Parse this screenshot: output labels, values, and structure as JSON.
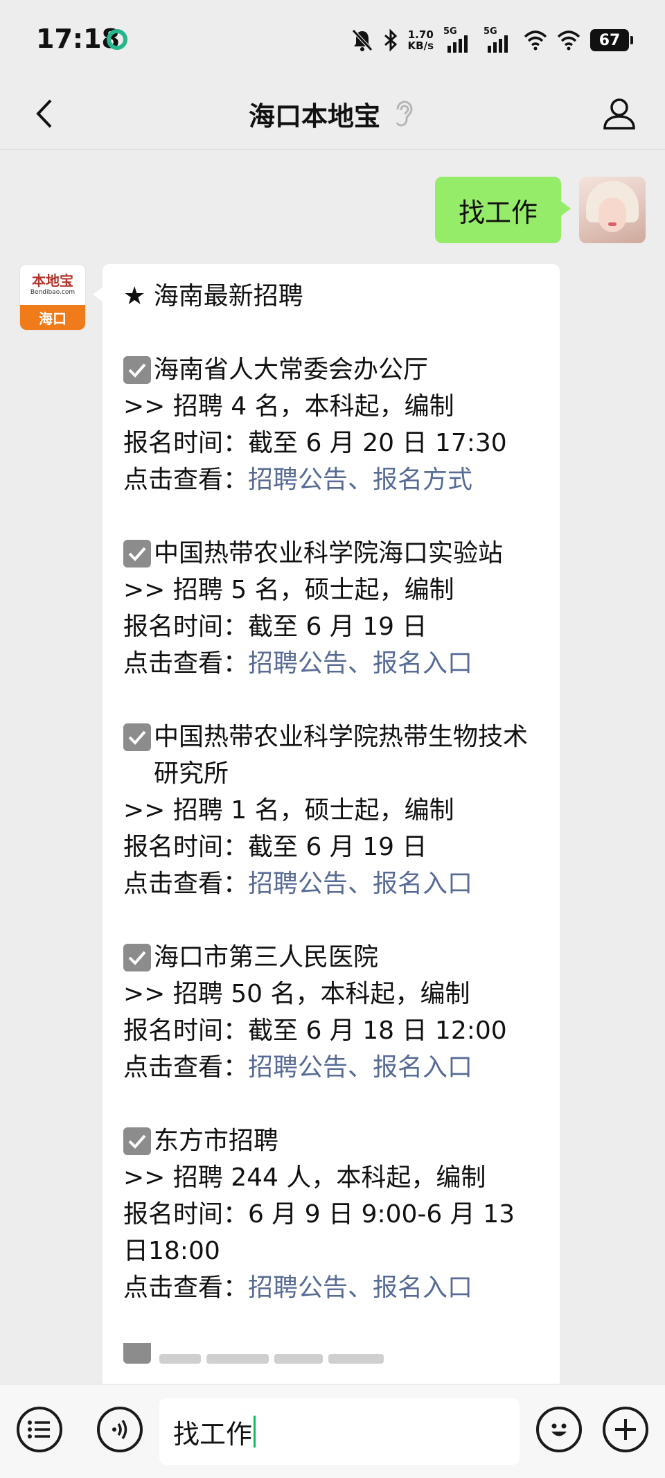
{
  "status_bar": {
    "time": "17:18",
    "speed_value": "1.70",
    "speed_unit": "KB/s",
    "signal1_tag": "5G",
    "signal2_tag": "5G",
    "battery": "67",
    "icons": [
      "app-sync-icon",
      "mute-bell-icon",
      "bluetooth-icon",
      "signal-icon",
      "wifi-icon",
      "battery-icon"
    ]
  },
  "nav": {
    "title": "海口本地宝",
    "icons": [
      "back-chevron-icon",
      "ear-icon",
      "profile-icon"
    ]
  },
  "chat": {
    "outgoing": {
      "text": "找工作"
    },
    "bot_avatar": {
      "logo": "本地宝",
      "domain": "Bendibao.com",
      "city": "海口"
    },
    "incoming": {
      "title": "★ 海南最新招聘",
      "jobs": [
        {
          "name": "海南省人大常委会办公厅",
          "detail": ">> 招聘 4 名，本科起，编制",
          "time": "报名时间：截至 6 月 20 日 17:30",
          "view_prefix": "点击查看：",
          "links": "招聘公告、报名方式"
        },
        {
          "name": "中国热带农业科学院海口实验站",
          "detail": ">> 招聘 5 名，硕士起，编制",
          "time": "报名时间：截至 6 月 19 日",
          "view_prefix": "点击查看：",
          "links": "招聘公告、报名入口"
        },
        {
          "name": "中国热带农业科学院热带生物技术研究所",
          "detail": ">> 招聘 1 名，硕士起，编制",
          "time": "报名时间：截至 6 月 19 日",
          "view_prefix": "点击查看：",
          "links": "招聘公告、报名入口"
        },
        {
          "name": "海口市第三人民医院",
          "detail": ">> 招聘 50 名，本科起，编制",
          "time": "报名时间：截至 6 月 18 日 12:00",
          "view_prefix": "点击查看：",
          "links": "招聘公告、报名入口"
        },
        {
          "name": "东方市招聘",
          "detail": ">> 招聘 244 人，本科起，编制",
          "time": "报名时间：6 月 9 日 9:00-6 月 13 日18:00",
          "view_prefix": "点击查看：",
          "links": "招聘公告、报名入口"
        }
      ]
    }
  },
  "input_bar": {
    "value": "找工作",
    "icons": [
      "menu-list-icon",
      "voice-icon",
      "emoji-icon",
      "add-icon"
    ]
  },
  "colors": {
    "background": "#ededed",
    "outgoing_bubble": "#95ec69",
    "link": "#576b95",
    "caret": "#07c160",
    "bot_avatar_orange": "#f07b1b"
  }
}
